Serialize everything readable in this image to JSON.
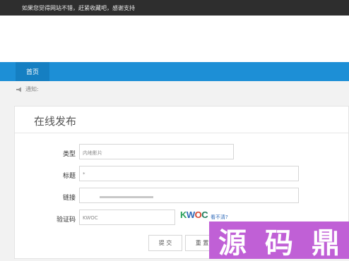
{
  "topbar": {
    "message": "如果您觉得网站不错，赶紧收藏吧，感谢支持"
  },
  "nav": {
    "home": "首页"
  },
  "notice": {
    "label": "通知:"
  },
  "form": {
    "title": "在线发布",
    "type_label": "类型",
    "type_value": "内地影片",
    "title_label": "标题",
    "title_value": "*",
    "link_label": "链接",
    "captcha_label": "验证码",
    "captcha_value": "KWOC",
    "captcha_text": {
      "c1": "K",
      "c2": "W",
      "c3": "O",
      "c4": "C"
    },
    "refresh_label": "看不清?",
    "submit_label": "提 交",
    "reset_label": "重 置"
  },
  "watermark": {
    "c1": "源",
    "c2": "码",
    "c3": "鼎"
  }
}
